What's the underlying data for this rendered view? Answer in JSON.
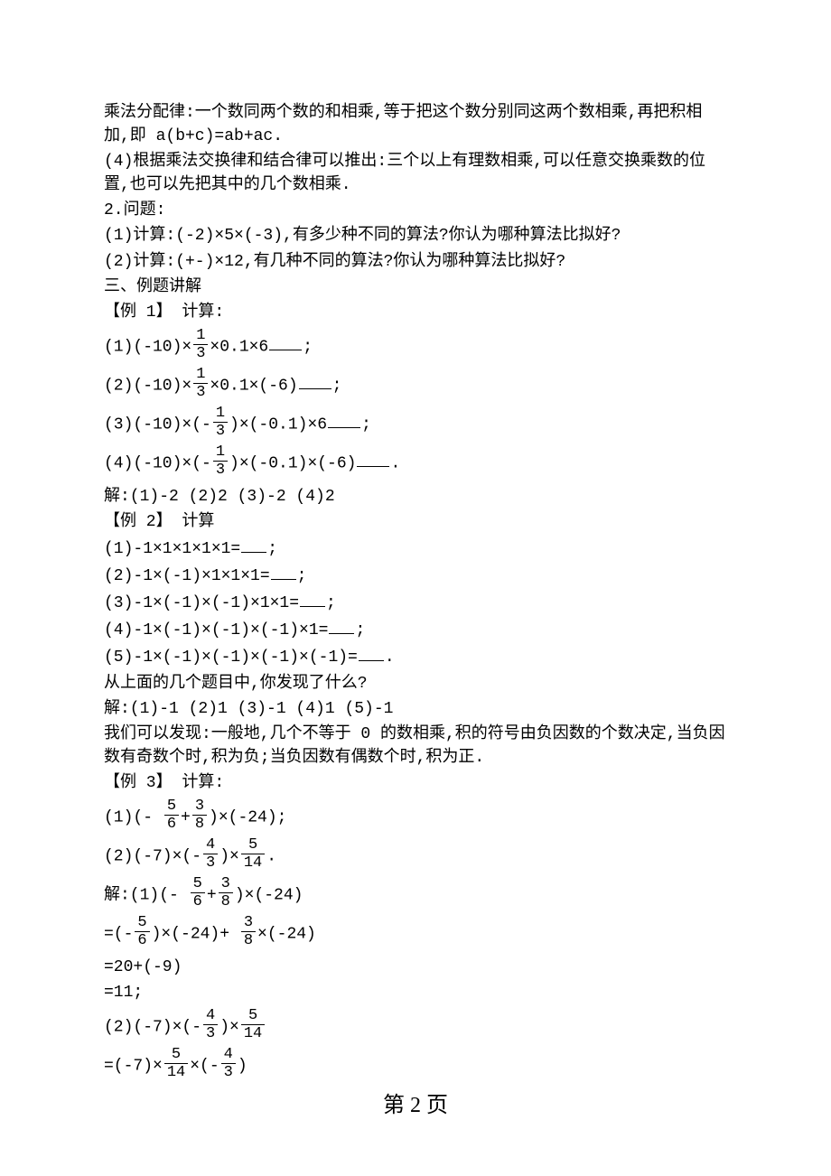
{
  "p1": "乘法分配律:一个数同两个数的和相乘,等于把这个数分别同这两个数相乘,再把积相加,即 a(b+c)=ab+ac.",
  "p2": "(4)根据乘法交换律和结合律可以推出:三个以上有理数相乘,可以任意交换乘数的位置,也可以先把其中的几个数相乘.",
  "q_title": "2.问题:",
  "q1": "(1)计算:(-2)×5×(-3),有多少种不同的算法?你认为哪种算法比拟好?",
  "q2": "(2)计算:(+-)×12,有几种不同的算法?你认为哪种算法比拟好?",
  "sec3": "三、例题讲解",
  "ex1_title": "【例 1】 计算:",
  "ex1_1a": "(1)(-10)×",
  "ex1_1b": "×0.1×6",
  "semi": ";",
  "ex1_2a": "(2)(-10)×",
  "ex1_2b": "×0.1×(-6)",
  "ex1_3a": "(3)(-10)×(-",
  "ex1_3b": ")×(-0.1)×6",
  "ex1_4a": "(4)(-10)×(-",
  "ex1_4b": ")×(-0.1)×(-6)",
  "period": ".",
  "ex1_sol": "解:(1)-2  (2)2  (3)-2  (4)2",
  "ex2_title": "【例 2】 计算",
  "ex2_1": "(1)-1×1×1×1×1=",
  "ex2_2": "(2)-1×(-1)×1×1×1=",
  "ex2_3": "(3)-1×(-1)×(-1)×1×1=",
  "ex2_4": "(4)-1×(-1)×(-1)×(-1)×1=",
  "ex2_5": "(5)-1×(-1)×(-1)×(-1)×(-1)=",
  "ex2_q": "从上面的几个题目中,你发现了什么?",
  "ex2_sol": "解:(1)-1  (2)1  (3)-1  (4)1  (5)-1",
  "ex2_conc": "我们可以发现:一般地,几个不等于 0 的数相乘,积的符号由负因数的个数决定,当负因数有奇数个时,积为负;当负因数有偶数个时,积为正.",
  "ex3_title": "【例 3】 计算:",
  "ex3_1a": "(1)(-",
  "plus": "+",
  "ex3_1b": ")×(-24);",
  "ex3_2a": "(2)(-7)×(-",
  "ex3_2b": ")×",
  "ex3_sol_a": "解:(1)(-",
  "ex3_sol_b": ")×(-24)",
  "ex3_sol_c1": "=(-",
  "ex3_sol_c2": ")×(-24)+",
  "ex3_sol_c3": "×(-24)",
  "ex3_sol_d": "=20+(-9)",
  "ex3_sol_e": "=11;",
  "ex3_sol2a": "(2)(-7)×(-",
  "ex3_sol2b": ")×",
  "ex3_sol2_c1": "=(-7)×",
  "ex3_sol2_c2": "×(-",
  "ex3_sol2_c3": ")",
  "f13n": "1",
  "f13d": "3",
  "f56n": "5",
  "f56d": "6",
  "f38n": "3",
  "f38d": "8",
  "f43n": "4",
  "f43d": "3",
  "f514n": "5",
  "f514d": "14",
  "footer": "第 2 页"
}
